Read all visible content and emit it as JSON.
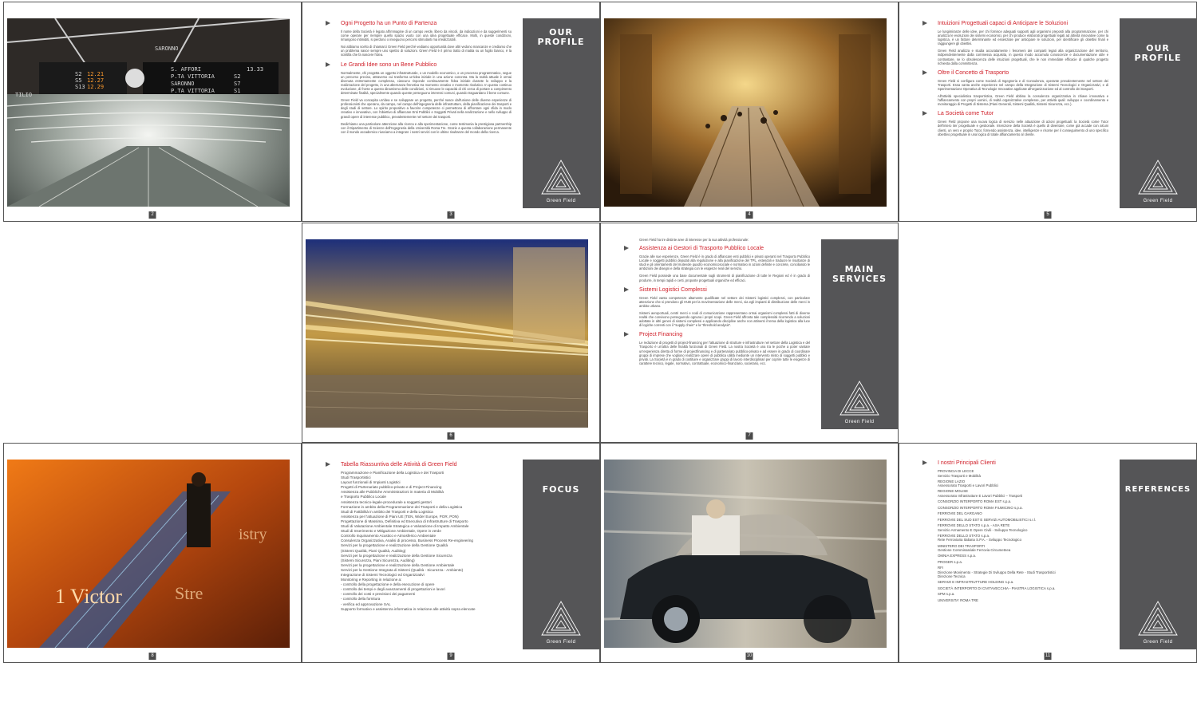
{
  "brand": {
    "logo_text": "Green Field",
    "accent": "#d0202a",
    "panel": "#555557"
  },
  "pages": {
    "p2": {
      "num": "2",
      "photo_text": [
        "S. AFFORI",
        "P.TA VITTORIA",
        "SARONNO",
        "P.TA VITTORIA",
        "12.21",
        "12.27",
        "12.29",
        "13.33",
        "S2",
        "S5",
        "S13",
        "S2",
        "S7",
        "S1",
        "SARONNO",
        "TILIO"
      ]
    },
    "p3": {
      "num": "3",
      "panel_title": "OUR\nPROFILE",
      "sections": [
        {
          "heading": "Ogni Progetto ha un Punto di Partenza",
          "paras": [
            "Il nome della Società è legato all'immagine di un campo verde, libero da vincoli, da indicazioni e da suggerimenti su come operare per riempire quello spazio vuoto con una idea progettuale efficace. Molti, in queste condizioni, rimangono intimiditi, si perdono o inseguono percorsi stimolanti ma irrealizzabili.",
            "Noi abbiamo scelto di chiamarci Green Field perché vediamo opportunità dove altri vedono mancanze e crediamo che un problema nasce sempre uno spettro di soluzioni. Green Field è il primo tratto di matita su un foglio bianco, è la scintilla che fa nascere l'idea."
          ]
        },
        {
          "heading": "Le Grandi Idee sono un Bene Pubblico",
          "paras": [
            "Normalmente, chi progetta un oggetto infrastrutturale, o un modello economico, o un processo programmatico, segue un percorso preciso, attraverso cui trasforma un'idea iniziale in una azione concreta. Ma la realtà attuale è ormai divenuta estremamente complessa, ciascuno risponde continuamente l'idea iniziale durante lo sviluppo e la realizzazione del progetto, in una alternanza frenetica tra momento creativo e momento risolutivo. In questo continuo evoluzione, di fronte a questo dinamismo delle condizioni, si rimuove le capacità di chi cerca di portare a compimento determinate finalità, specialmente quando queste perseguono interessi comuni, quando traguardano il bene comune.",
            "Green Field va concepita un'idea e se sviluppare un progetto, perché nasce dall'unione delle diverse esperienze di professionisti che operano, da campo, nel campo dell'ingegneria delle infrastrutture, della pianificazione dei trasporti e degli studi di settore. Lo spirito propositivo a favorire competenze ci permettono di affrontare ogni sfida in modo creativo e innovativo, con l'obiettivo di affiancare Enti Pubblici e Soggetti Privati nella realizzazione e nello sviluppo di grandi opere di interesse pubblico, prevalentemente nel settore dei trasporti.",
            "Dedichiamo una particolare attenzione alla ricerca e alla sperimentazione, come testimonia la prestigiosa partnership con il Dipartimento di Scienze dell'Ingegneria della Università Roma Tre. Grazie a questa collaborazione permanente con il mondo accademico riusciamo a integrare i nostri servizi con le ultime risultanze del mondo della ricerca."
          ]
        }
      ]
    },
    "p4": {
      "num": "4"
    },
    "p5": {
      "num": "5",
      "panel_title": "OUR\nPROFILE",
      "sections": [
        {
          "heading": "Intuizioni Progettuali capaci di Anticipare le Soluzioni",
          "paras": [
            "Le lungimiranze delle idee, per chi fornisce adeguati supporti agli organismi preposti alla programmazione, per chi analizza le evoluzioni dei sistemi economici, per chi produce elaborati progettuali legati ad attività innovative come la logistica, è un fattore determinante ed essenziale per anticipare le soluzioni, per identificare gli obiettivi finali e raggiungere gli obiettivi.",
            "Green Field analizza e studia accuratamente i fenomeni dei comparti legati alla organizzazione del territorio, indipendentemente dalla commessa acquisita, in questo modo accumula conoscenze e documentazione utile e contrastare, se lo obsolescenza delle intuizioni progettuali, che le non immediate efficacie di qualche progetto richiesta dalla committenza."
          ]
        },
        {
          "heading": "Oltre il Concetto di Trasporto",
          "paras": [
            "Green Field si configura come Società di Ingegneria e di Consulenza, operante prevalentemente nel settore dei Trasporti. Essa vanta anche esperienze nel campo della Integrazione di Sistemi Tecnologici e Organizzativi, e di Sperimentazione Operativa di Tecnologie Innovative applicate all'organizzazione ed al controllo dei trasporti.",
            "All'attività specialistica trasportistica, Green Field abbina la consulenza organizzativa in chiave innovativa e l'affiancamento con propri uomini, di realtà organizzative complesse, per attività quali: sviluppo e coordinamento e monitoraggio di Progetti di Sistema (Piani Generali, Sistemi Qualità, Sistemi Sicurezza, ecc.)."
          ]
        },
        {
          "heading": "La Società come Tutor",
          "paras": [
            "Green Field propone una nuova logica di servizio nelle attuazione di azioni progettuali: la Società come Tutor dell'intero iter progettuale e gestionale. Intenzione della Società è quello di diventare, come già accade con alcuni clienti, un vero e proprio Tutor, fornendo assistenza, idee, intelligenze e risorse per il conseguimento di uno specifico obiettivo progettuale in una logica di totale affiancamento al cliente."
          ]
        }
      ]
    },
    "p6": {
      "num": "6"
    },
    "p7": {
      "num": "7",
      "panel_title": "MAIN\nSERVICES",
      "intro": "Green Field ha tre distinte aree di interesse per la sua attività professionale:",
      "sections": [
        {
          "heading": "Assistenza ai Gestori di Trasporto Pubblico Locale",
          "paras": [
            "Grazie alle sue esperienze, Green Field è in grado di affiancare enti pubblici e privati operanti nel Trasporto Pubblico Locale e soggetti pubblici deputati alla regolazione e alla pianificazione del TPL, estendoli e traducre le risultanze di studi e gli orientamenti del mutevole quadro economicosociale e normativo in azioni definite e concrete, conciliando le ambizioni dei disegni e della strategia con le esigenze reali del servizio.",
            "Green Field possiede una base documentale sugli strumenti di pianificazione di tutte le Regioni ed è in grado di produrre, in tempi rapidi e certi, proposte progettuali organiche ed efficaci."
          ]
        },
        {
          "heading": "Sistemi Logistici Complessi",
          "paras": [
            "Green Field vanta competenze altamente qualificate nel settore dei Sistemi logistici complessi, con particolare attenzione che si prendono gli HUB per la movimentazione delle merci, sia egli impianti di distribuzione delle merci in ambito urbano.",
            "Sistemi aeroportuali, centri merci e nodi di comunicazione rappresentano ormai organismi complessi fatti di diverse realtà che convivono perseguendo ognuna i propri scopi. Green Field affronta tale complessità ricorrendo a soluzioni adottate in altri generi di sistemi complessi e applicando discipline anche non attinenti il tema della logistica alla luce di logiche correnti con il \"supply chain\" e la \"threshold analysis\"."
          ]
        },
        {
          "heading": "Project Financing",
          "paras": [
            "Le redazione di progetti di project-financing per l'attuazione di strutture e infrastrutture nel settore della Logistica e del Trasporto è un'altra delle finalità funzionali di Green Field. La nostra Società è una tra le poche a poter vantare un'esperienza diretta di forme di projectfinancing e di partenariato pubblico-privato e ad essere in grado di coordinare gruppi di imprese che vogliono realizzare opere di pubblica utilità mediante un intervento misto di soggetti pubblici e privati. La Società è in grado di costituire e organizzare gruppi di lavoro interdisciplinari per coprire tutte le esigenze di carattere tecnico, legale, normativo, contrattuale, economico-finanziario, societario, ecc."
          ]
        }
      ]
    },
    "p8": {
      "num": "8",
      "photo_text": [
        "1 Victor",
        "Stre",
        "istry"
      ]
    },
    "p9": {
      "num": "9",
      "panel_title": "FOCUS",
      "heading": "Tabella Riassuntiva delle Attività di Green Field",
      "items": [
        "Programmazione e Pianificazione della Logistica e dei Trasporti",
        "Studi Trasportistici",
        "Layout funzionali di Impianti Logistici",
        "Progetti di Partenariato pubblico-privato e di Project-Financing",
        "Assistenza alle Pubbliche Amministrazioni in materia di Mobilità",
        "e Trasporto Pubblico Locale",
        "Assistenza tecnico-legale-procedurale a soggetti gestori",
        "Formazione in ambito della Programmazione dei Trasporti e della Logistica",
        "Studi di Fattibilità in ambito dei Trasporti e della Logistica",
        "Assistenza per l'attuazione di Piani UE (TEN, Wider Europe, POR, PON)",
        "Progettazione di Massima, Definitiva ed Esecutiva di Infrastrutture di Trasporto",
        "Studi di Valutazione Ambientale Strategica e Valutazione di Impatto Ambientale",
        "Studi di Inserimento e Mitigazione Ambientale, Opere in verde",
        "Controllo Inquinamento Acustico e Atmosferico Ambientale",
        "Consulenza Organizzativa, Analisi di processo, Business Process Re-engineering",
        "Servizi per la progettazione e realizzazione della Gestione Qualità",
        "(Sistemi Qualità, Piani Qualità, Auditing)",
        "Servizi per la progettazione e realizzazione della Gestione Sicurezza",
        "(Sistemi Sicurezza, Piani Sicurezza, Auditing)",
        "Servizi per la progettazione e realizzazione della Gestione Ambientale",
        "Servizi per la Gestione Integrata di Sistemi (Qualità - Sicurezza - Ambiente)",
        "Integrazione di Sistemi Tecnologici ed Organizzativi",
        "Monitoring e Reporting in relazione a:",
        "- controllo della progettazione e della esecuzione di opere",
        "- controllo dei tempi e degli avanzamenti di progettazioni e lavori",
        "- controllo dei costi e previsioni dei pagamenti",
        "- controllo della fornitura",
        "- verifica ed approvazione SAL",
        "Supporto formativo e assistenza informatica in relazione alle attività sopra elencate"
      ]
    },
    "p10": {
      "num": "10"
    },
    "p11": {
      "num": "11",
      "panel_title": "REFERENCES",
      "heading": "I nostri Principali Clienti",
      "clients": [
        {
          "name": "PROVINCIA DI LECCE",
          "sub": "Servizio Trasporti e Mobilità"
        },
        {
          "name": "REGIONE LAZIO",
          "sub": "Assessorato Trasporti e Lavori Pubblici"
        },
        {
          "name": "REGIONE MOLISE",
          "sub": "Assessorato Infrastrutture E Lavori Pubblici – Trasporti"
        },
        {
          "name": "CONSORZIO INTERPORTO ROMA EST s.p.a.",
          "sub": ""
        },
        {
          "name": "CONSORZIO INTERPORTO ROMA FIUMICINO s.p.a.",
          "sub": ""
        },
        {
          "name": "FERROVIE DEL GARGANO",
          "sub": ""
        },
        {
          "name": "FERROVIE DEL SUD EST E SERVIZI AUTOMOBILISTICI s.r.l.",
          "sub": ""
        },
        {
          "name": "FERROVIE DELLO STATO s.p.a. - ASA RETE",
          "sub": "Servizio Armamento E Opere Civili - Sviluppo Tecnologico"
        },
        {
          "name": "FERROVIE DELLO STATO s.p.a.",
          "sub": "Rete Ferroviaria Italiana S.P.A. - Sviluppo Tecnologico"
        },
        {
          "name": "MINISTERO DEI TRASPORTI",
          "sub": "Gestione Commissariale Ferrovia Circumetnea"
        },
        {
          "name": "OMNIA EXPRESS s.p.a.",
          "sub": ""
        },
        {
          "name": "PROGER s.p.a.",
          "sub": ""
        },
        {
          "name": "RFI",
          "sub": "Direzione Movimento - Strategie Di Sviluppo Della Rete - Studi Trasportistici\nDirezione Tecnica"
        },
        {
          "name": "SERVIZI E INFRASTRUTTURE HOLDING s.p.a.",
          "sub": ""
        },
        {
          "name": "SOCIETÀ INTERPORTO DI CIVITAVECCHIA - PIASTRA LOGISTICA s.p.a.",
          "sub": ""
        },
        {
          "name": "SPM s.p.a.",
          "sub": ""
        },
        {
          "name": "UNIVERSITA' ROMA TRE",
          "sub": ""
        }
      ]
    }
  }
}
